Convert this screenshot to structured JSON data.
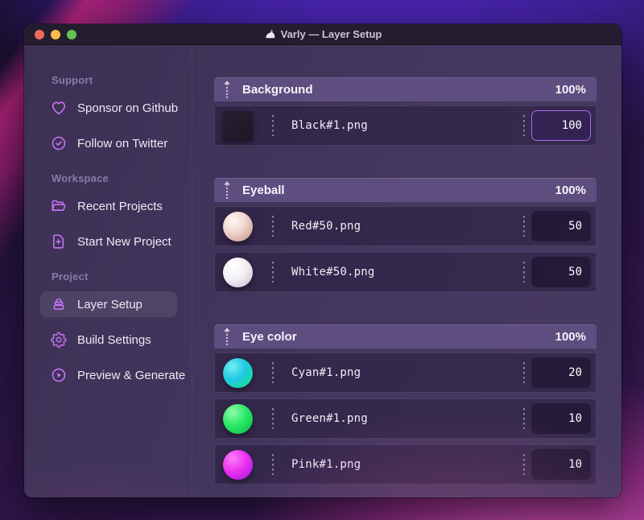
{
  "window": {
    "title": "Varly — Layer Setup",
    "app_icon": "unicorn-icon",
    "traffic_lights": [
      "close",
      "minimize",
      "zoom"
    ]
  },
  "sidebar": {
    "sections": [
      {
        "label": "Support",
        "items": [
          {
            "icon": "heart-icon",
            "label": "Sponsor on Github",
            "active": false
          },
          {
            "icon": "badge-check-icon",
            "label": "Follow on Twitter",
            "active": false
          }
        ]
      },
      {
        "label": "Workspace",
        "items": [
          {
            "icon": "folder-icon",
            "label": "Recent Projects",
            "active": false
          },
          {
            "icon": "document-add-icon",
            "label": "Start New Project",
            "active": false
          }
        ]
      },
      {
        "label": "Project",
        "items": [
          {
            "icon": "layers-icon",
            "label": "Layer Setup",
            "active": true
          },
          {
            "icon": "gear-icon",
            "label": "Build Settings",
            "active": false
          },
          {
            "icon": "play-circle-icon",
            "label": "Preview & Generate",
            "active": false
          }
        ]
      }
    ]
  },
  "main": {
    "groups": [
      {
        "name": "Background",
        "weight": "100%",
        "layers": [
          {
            "file": "Black#1.png",
            "value": "100",
            "thumb": "black-square",
            "focused": true
          }
        ]
      },
      {
        "name": "Eyeball",
        "weight": "100%",
        "layers": [
          {
            "file": "Red#50.png",
            "value": "50",
            "thumb": "red-sphere",
            "focused": false
          },
          {
            "file": "White#50.png",
            "value": "50",
            "thumb": "white-sphere",
            "focused": false
          }
        ]
      },
      {
        "name": "Eye color",
        "weight": "100%",
        "layers": [
          {
            "file": "Cyan#1.png",
            "value": "20",
            "thumb": "cyan-sphere",
            "focused": false
          },
          {
            "file": "Green#1.png",
            "value": "10",
            "thumb": "green-sphere",
            "focused": false
          },
          {
            "file": "Pink#1.png",
            "value": "10",
            "thumb": "pink-sphere",
            "focused": false
          }
        ]
      }
    ]
  },
  "colors": {
    "accent_purple": "#c273ef",
    "focused_border": "#a968ec",
    "group_header": "#5e4e80",
    "titlebar": "#241c2f",
    "traffic_red": "#ee6a5f",
    "traffic_yellow": "#f5bd4f",
    "traffic_green": "#61c354",
    "wallpaper_pink": "#f05fc4",
    "wallpaper_blue": "#5f2fe8"
  }
}
